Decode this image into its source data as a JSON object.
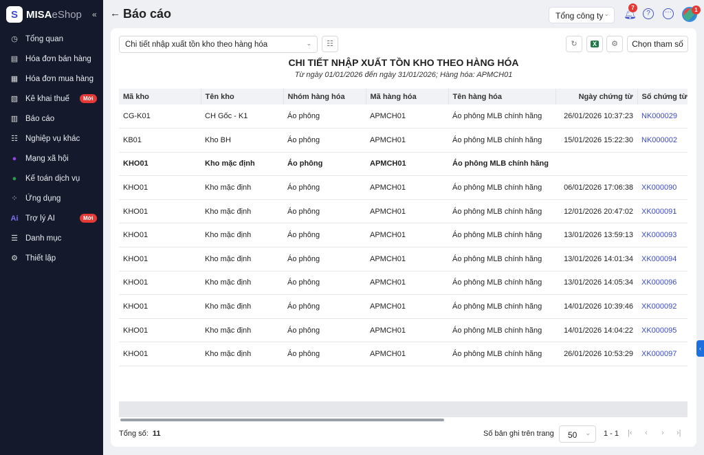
{
  "brand": {
    "logo": "S",
    "name_bold": "MISA",
    "name_light": "eShop"
  },
  "sidebar": {
    "items": [
      {
        "label": "Tổng quan",
        "icon": "◷"
      },
      {
        "label": "Hóa đơn bán hàng",
        "icon": "▤"
      },
      {
        "label": "Hóa đơn mua hàng",
        "icon": "▦"
      },
      {
        "label": "Kê khai thuế",
        "icon": "▧",
        "badge": "Mới"
      },
      {
        "label": "Báo cáo",
        "icon": "▥"
      },
      {
        "label": "Nghiệp vụ khác",
        "icon": "☷"
      },
      {
        "label": "Mạng xã hội",
        "icon": "●"
      },
      {
        "label": "Kế toán dịch vụ",
        "icon": "●"
      },
      {
        "label": "Ứng dụng",
        "icon": "⁘"
      },
      {
        "label": "Trợ lý AI",
        "icon": "Ai",
        "badge": "Mới"
      },
      {
        "label": "Danh mục",
        "icon": "☰"
      },
      {
        "label": "Thiết lập",
        "icon": "⚙"
      }
    ]
  },
  "header": {
    "title": "Báo cáo",
    "company": "Tổng công ty",
    "notifications": "7",
    "avatar_badge": "1"
  },
  "toolbar": {
    "report_select": "Chi tiết nhập xuất tồn kho theo hàng hóa",
    "params_button": "Chọn tham số"
  },
  "report": {
    "title": "CHI TIẾT NHẬP XUẤT TỒN KHO THEO HÀNG HÓA",
    "subtitle": "Từ ngày 01/01/2026 đến ngày 31/01/2026; Hàng hóa: APMCH01"
  },
  "table": {
    "columns": [
      "Mã kho",
      "Tên kho",
      "Nhóm hàng hóa",
      "Mã hàng hóa",
      "Tên hàng hóa",
      "Ngày chứng từ",
      "Số chứng từ"
    ],
    "rows": [
      [
        "CG-K01",
        "CH Gốc - K1",
        "Áo phông",
        "APMCH01",
        "Áo phông MLB chính hãng",
        "26/01/2026 10:37:23",
        "NK000029"
      ],
      [
        "KB01",
        "Kho BH",
        "Áo phông",
        "APMCH01",
        "Áo phông MLB chính hãng",
        "15/01/2026 15:22:30",
        "NK000002"
      ],
      [
        "KHO01",
        "Kho mặc định",
        "Áo phông",
        "APMCH01",
        "Áo phông MLB chính hãng",
        "",
        ""
      ],
      [
        "KHO01",
        "Kho mặc định",
        "Áo phông",
        "APMCH01",
        "Áo phông MLB chính hãng",
        "06/01/2026 17:06:38",
        "XK000090"
      ],
      [
        "KHO01",
        "Kho mặc định",
        "Áo phông",
        "APMCH01",
        "Áo phông MLB chính hãng",
        "12/01/2026 20:47:02",
        "XK000091"
      ],
      [
        "KHO01",
        "Kho mặc định",
        "Áo phông",
        "APMCH01",
        "Áo phông MLB chính hãng",
        "13/01/2026 13:59:13",
        "XK000093"
      ],
      [
        "KHO01",
        "Kho mặc định",
        "Áo phông",
        "APMCH01",
        "Áo phông MLB chính hãng",
        "13/01/2026 14:01:34",
        "XK000094"
      ],
      [
        "KHO01",
        "Kho mặc định",
        "Áo phông",
        "APMCH01",
        "Áo phông MLB chính hãng",
        "13/01/2026 14:05:34",
        "XK000096"
      ],
      [
        "KHO01",
        "Kho mặc định",
        "Áo phông",
        "APMCH01",
        "Áo phông MLB chính hãng",
        "14/01/2026 10:39:46",
        "XK000092"
      ],
      [
        "KHO01",
        "Kho mặc định",
        "Áo phông",
        "APMCH01",
        "Áo phông MLB chính hãng",
        "14/01/2026 14:04:22",
        "XK000095"
      ],
      [
        "KHO01",
        "Kho mặc định",
        "Áo phông",
        "APMCH01",
        "Áo phông MLB chính hãng",
        "26/01/2026 10:53:29",
        "XK000097"
      ]
    ],
    "bold_row": 2
  },
  "footer": {
    "total_label": "Tổng số:",
    "total": "11",
    "per_page_label": "Số bản ghi trên trang",
    "per_page": "50",
    "range": "1 - 1"
  }
}
